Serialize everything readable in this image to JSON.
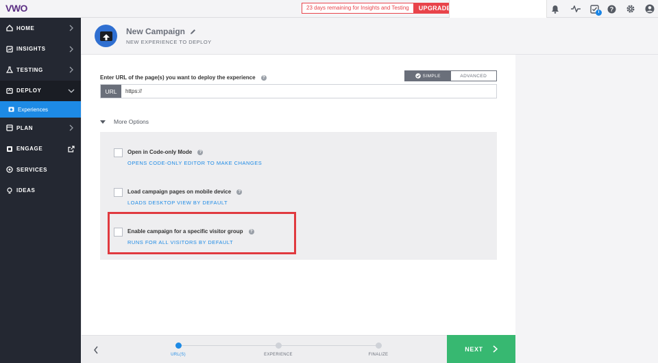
{
  "brand": {
    "logo": "VWO"
  },
  "topbar": {
    "trial_text": "23 days remaining for Insights and Testing",
    "upgrade_label": "UPGRADE",
    "icons": [
      "bell-icon",
      "activity-icon",
      "tasks-icon",
      "help-icon",
      "gear-icon",
      "user-icon"
    ],
    "tasks_badge": "i"
  },
  "sidebar": {
    "items": [
      {
        "label": "HOME",
        "icon": "home-icon"
      },
      {
        "label": "INSIGHTS",
        "icon": "insights-icon"
      },
      {
        "label": "TESTING",
        "icon": "flask-icon"
      },
      {
        "label": "DEPLOY",
        "icon": "deploy-icon"
      },
      {
        "label": "PLAN",
        "icon": "plan-icon"
      },
      {
        "label": "ENGAGE",
        "icon": "engage-icon"
      },
      {
        "label": "SERVICES",
        "icon": "services-icon"
      },
      {
        "label": "IDEAS",
        "icon": "bulb-icon"
      }
    ],
    "active_sub_item": "Experiences"
  },
  "header": {
    "title": "New Campaign",
    "subtitle": "NEW EXPERIENCE TO DEPLOY"
  },
  "main": {
    "url_label": "Enter URL of the page(s) you want to deploy the experience",
    "mode_simple": "SIMPLE",
    "mode_advanced": "ADVANCED",
    "url_tag": "URL",
    "url_value": "https://",
    "more_options_label": "More Options",
    "options": [
      {
        "title": "Open in Code-only Mode",
        "subtitle": "OPENS CODE-ONLY EDITOR TO MAKE CHANGES",
        "checked": false
      },
      {
        "title": "Load campaign pages on mobile device",
        "subtitle": "LOADS DESKTOP VIEW BY DEFAULT",
        "checked": false
      },
      {
        "title": "Enable campaign for a specific visitor group",
        "subtitle": "RUNS FOR ALL VISITORS BY DEFAULT",
        "checked": false
      }
    ]
  },
  "footer": {
    "steps": [
      "URL(S)",
      "EXPERIENCE",
      "FINALIZE"
    ],
    "active_step": 0,
    "next_label": "NEXT"
  },
  "colors": {
    "sidebar": "#242832",
    "accent_blue": "#1d8ae5",
    "next_green": "#37b871",
    "upgrade_red": "#e8434a",
    "highlight_red": "#e0393f"
  }
}
